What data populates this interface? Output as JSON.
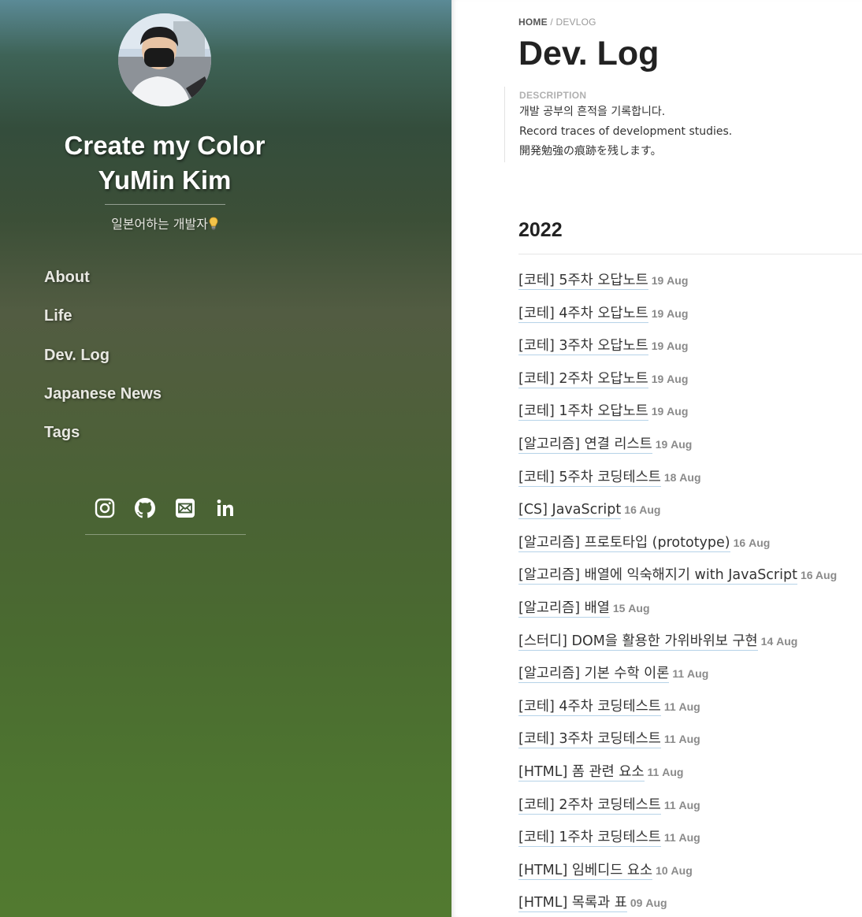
{
  "sidebar": {
    "title_line1": "Create my Color",
    "title_line2": "YuMin Kim",
    "tagline": "일본어하는 개발자",
    "nav": [
      {
        "label": "About"
      },
      {
        "label": "Life"
      },
      {
        "label": "Dev. Log"
      },
      {
        "label": "Japanese News"
      },
      {
        "label": "Tags"
      }
    ],
    "socials": [
      "instagram-icon",
      "github-icon",
      "mail-icon",
      "linkedin-icon"
    ]
  },
  "main": {
    "breadcrumb": {
      "home": "HOME",
      "sep": "/",
      "current": "DEVLOG"
    },
    "title": "Dev. Log",
    "description": {
      "label": "DESCRIPTION",
      "lines": [
        "개발 공부의 흔적을 기록합니다.",
        "Record traces of development studies.",
        "開発勉強の痕跡を残します。"
      ]
    },
    "year": "2022",
    "posts": [
      {
        "title": "[코테] 5주차 오답노트",
        "date": "19 Aug"
      },
      {
        "title": "[코테] 4주차 오답노트",
        "date": "19 Aug"
      },
      {
        "title": "[코테] 3주차 오답노트",
        "date": "19 Aug"
      },
      {
        "title": "[코테] 2주차 오답노트",
        "date": "19 Aug"
      },
      {
        "title": "[코테] 1주차 오답노트",
        "date": "19 Aug"
      },
      {
        "title": "[알고리즘] 연결 리스트",
        "date": "19 Aug"
      },
      {
        "title": "[코테] 5주차 코딩테스트",
        "date": "18 Aug"
      },
      {
        "title": "[CS] JavaScript",
        "date": "16 Aug"
      },
      {
        "title": "[알고리즘] 프로토타입 (prototype)",
        "date": "16 Aug"
      },
      {
        "title": "[알고리즘] 배열에 익숙해지기 with JavaScript",
        "date": "16 Aug"
      },
      {
        "title": "[알고리즘] 배열",
        "date": "15 Aug"
      },
      {
        "title": "[스터디] DOM을 활용한 가위바위보 구현",
        "date": "14 Aug"
      },
      {
        "title": "[알고리즘] 기본 수학 이론",
        "date": "11 Aug"
      },
      {
        "title": "[코테] 4주차 코딩테스트",
        "date": "11 Aug"
      },
      {
        "title": "[코테] 3주차 코딩테스트",
        "date": "11 Aug"
      },
      {
        "title": "[HTML] 폼 관련 요소",
        "date": "11 Aug"
      },
      {
        "title": "[코테] 2주차 코딩테스트",
        "date": "11 Aug"
      },
      {
        "title": "[코테] 1주차 코딩테스트",
        "date": "11 Aug"
      },
      {
        "title": "[HTML] 임베디드 요소",
        "date": "10 Aug"
      },
      {
        "title": "[HTML] 목록과 표",
        "date": "09 Aug"
      }
    ]
  }
}
